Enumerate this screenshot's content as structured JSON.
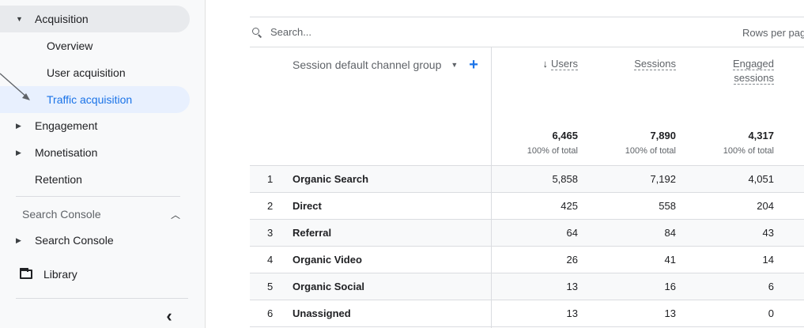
{
  "sidebar": {
    "acquisition": "Acquisition",
    "overview": "Overview",
    "user_acquisition": "User acquisition",
    "traffic_acquisition": "Traffic acquisition",
    "engagement": "Engagement",
    "monetisation": "Monetisation",
    "retention": "Retention",
    "search_console_section": "Search Console",
    "search_console_item": "Search Console",
    "library": "Library",
    "collapse": "‹"
  },
  "search": {
    "placeholder": "Search..."
  },
  "rows_per_page": "Rows per page",
  "table": {
    "dimension_header": "Session default channel group",
    "metrics": [
      {
        "label": "Users",
        "line2": "",
        "sorted": true,
        "total": "6,465",
        "pct": "100% of total"
      },
      {
        "label": "Sessions",
        "line2": "",
        "sorted": false,
        "total": "7,890",
        "pct": "100% of total"
      },
      {
        "label": "Engaged",
        "line2": "sessions",
        "sorted": false,
        "total": "4,317",
        "pct": "100% of total"
      }
    ],
    "rows": [
      {
        "idx": "1",
        "channel": "Organic Search",
        "users": "5,858",
        "sessions": "7,192",
        "engaged": "4,051"
      },
      {
        "idx": "2",
        "channel": "Direct",
        "users": "425",
        "sessions": "558",
        "engaged": "204"
      },
      {
        "idx": "3",
        "channel": "Referral",
        "users": "64",
        "sessions": "84",
        "engaged": "43"
      },
      {
        "idx": "4",
        "channel": "Organic Video",
        "users": "26",
        "sessions": "41",
        "engaged": "14"
      },
      {
        "idx": "5",
        "channel": "Organic Social",
        "users": "13",
        "sessions": "16",
        "engaged": "6"
      },
      {
        "idx": "6",
        "channel": "Unassigned",
        "users": "13",
        "sessions": "13",
        "engaged": "0"
      }
    ]
  },
  "colors": {
    "accent": "#1a73e8",
    "active_bg": "#e8f0fe",
    "border": "#dadce0",
    "muted": "#5f6368"
  },
  "icons": {
    "sort": "arrow-down-icon",
    "add": "plus-icon",
    "search": "search-icon",
    "library": "folder-icon"
  }
}
